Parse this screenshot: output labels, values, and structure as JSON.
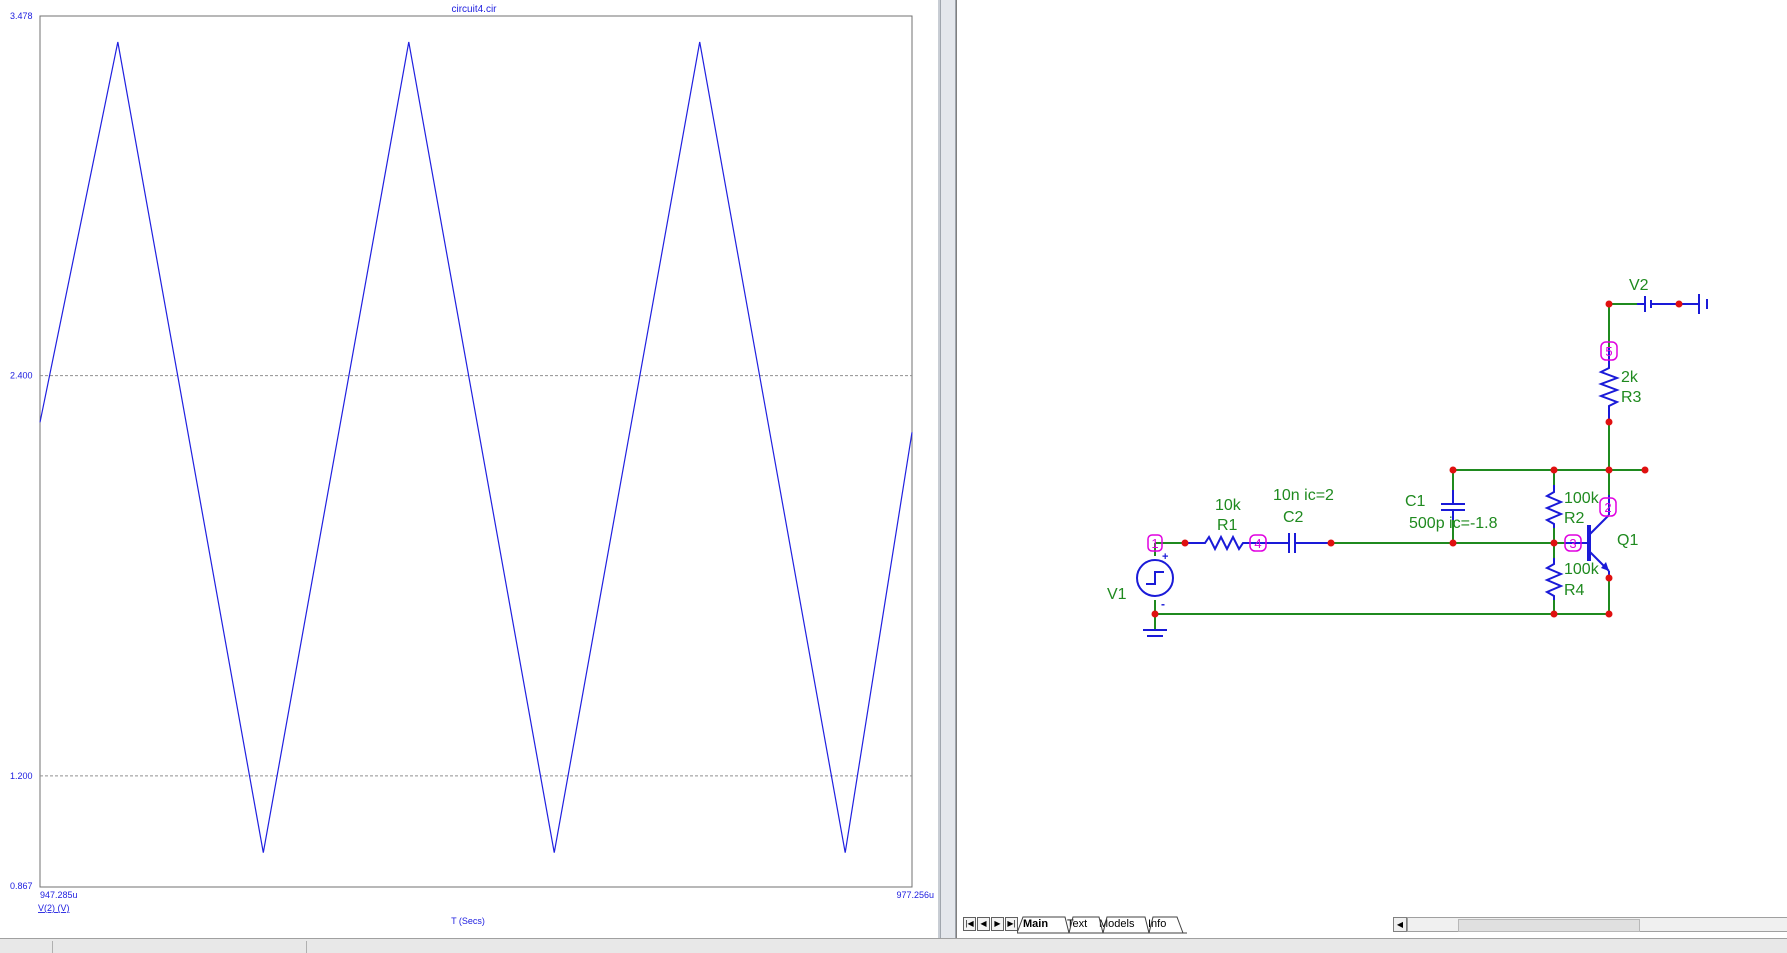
{
  "plot": {
    "title": "circuit4.cir",
    "y_ticks": [
      "3.478",
      "2.400",
      "1.200",
      "0.867"
    ],
    "x_start": "947.285u",
    "x_end": "977.256u",
    "trace_label": "V(2) (V)",
    "x_axis_label": "T (Secs)",
    "trace_color": "#2020e0"
  },
  "chart_data": {
    "type": "line",
    "title": "circuit4.cir",
    "xlabel": "T (Secs)",
    "ylabel": "",
    "xlim": [
      947.285,
      977.256
    ],
    "ylim": [
      0.867,
      3.478
    ],
    "series": [
      {
        "name": "V(2) (V)",
        "x": [
          947.285,
          949.96,
          954.96,
          959.96,
          964.96,
          969.96,
          974.96,
          977.256
        ],
        "values": [
          2.26,
          3.4,
          0.97,
          3.4,
          0.97,
          3.4,
          0.97,
          2.23
        ]
      }
    ],
    "grid_y": [
      2.4,
      1.2
    ]
  },
  "schematic": {
    "V2": "V2",
    "R3_value": "2k",
    "R3_name": "R3",
    "R1_value": "10k",
    "R1_name": "R1",
    "C2_value": "10n ic=2",
    "C2_name": "C2",
    "C1_name": "C1",
    "C1_value": "500p ic=-1.8",
    "R2_value": "100k",
    "R2_name": "R2",
    "R4_value": "100k",
    "R4_name": "R4",
    "Q1_name": "Q1",
    "V1_name": "V1",
    "node1": "1",
    "node2": "2",
    "node3": "3",
    "node4": "4",
    "node5": "5",
    "plus": "+",
    "minus": "-"
  },
  "tabs": {
    "nav_first": "|◀",
    "nav_prev": "◀",
    "nav_next": "▶",
    "nav_last": "▶|",
    "items": [
      "Main",
      "Text",
      "Models",
      "Info"
    ],
    "scroll_left": "◀"
  }
}
